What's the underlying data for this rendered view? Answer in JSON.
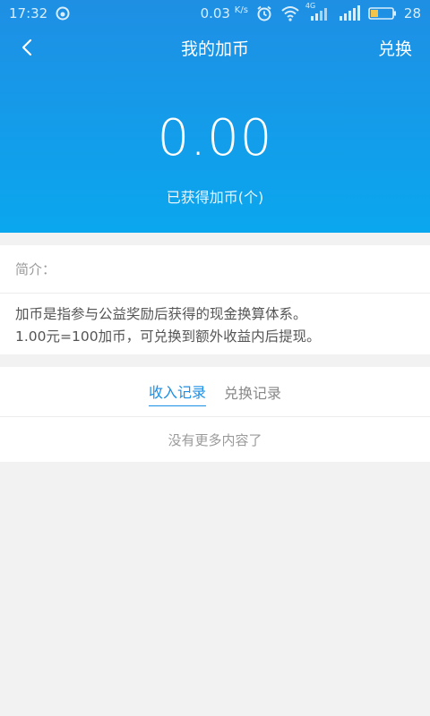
{
  "statusbar": {
    "time": "17:32",
    "speed": "0.03",
    "speed_unit": "K/s",
    "network_label": "4G",
    "battery": "28"
  },
  "navbar": {
    "title": "我的加币",
    "action": "兑换"
  },
  "balance": {
    "amount": "0.00",
    "label": "已获得加币(个)"
  },
  "intro": {
    "title": "简介：",
    "line1": "加币是指参与公益奖励后获得的现金换算体系。",
    "line2": "1.00元=100加币，可兑换到额外收益内后提现。"
  },
  "records": {
    "tabs": [
      {
        "label": "收入记录",
        "active": true
      },
      {
        "label": "兑换记录",
        "active": false
      }
    ],
    "empty_text": "没有更多内容了"
  },
  "colors": {
    "header_top": "#1f8fe4",
    "header_bottom": "#0aa7ee",
    "accent": "#1a8fe6"
  }
}
